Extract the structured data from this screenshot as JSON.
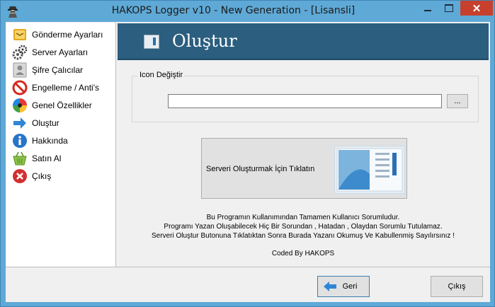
{
  "window": {
    "title": "HAKOPS Logger v10 - New Generation  - [Lisansli]",
    "close_glyph": "✕"
  },
  "sidebar": {
    "items": [
      {
        "label": "Gönderme Ayarları",
        "icon": "send-settings-icon"
      },
      {
        "label": "Server Ayarları",
        "icon": "gears-icon"
      },
      {
        "label": "Şifre Çalıcılar",
        "icon": "user-card-icon"
      },
      {
        "label": "Engelleme / Anti's",
        "icon": "prohibited-icon"
      },
      {
        "label": "Genel Özellikler",
        "icon": "color-wheel-icon"
      },
      {
        "label": "Oluştur",
        "icon": "arrow-right-icon"
      },
      {
        "label": "Hakkında",
        "icon": "info-icon"
      },
      {
        "label": "Satın Al",
        "icon": "basket-icon"
      },
      {
        "label": "Çıkış",
        "icon": "close-circle-icon"
      }
    ]
  },
  "header": {
    "title": "Oluştur"
  },
  "icon_group": {
    "label": "Icon Değiştir",
    "path_value": "",
    "browse_label": "..."
  },
  "create": {
    "label": "Serveri Oluşturmak İçin Tıklatın"
  },
  "disclaimer": {
    "line1": "Bu Programın Kullanımından Tamamen Kullanıcı Sorumludur.",
    "line2": "Programı Yazan Oluşabilecek Hiç Bir Sorundan , Hatadan , Olaydan Sorumlu Tutulamaz.",
    "line3": "Serveri Oluştur Butonuna Tıklatıktan Sonra Burada Yazanı Okumuş Ve Kabullenmiş Sayılırsınız !",
    "coded_by": "Coded By HAKOPS"
  },
  "footer": {
    "back_label": "Geri",
    "exit_label": "Çıkış"
  },
  "colors": {
    "title_bar": "#5fa9d6",
    "banner": "#2b5e7f",
    "close_button": "#c7402d"
  }
}
